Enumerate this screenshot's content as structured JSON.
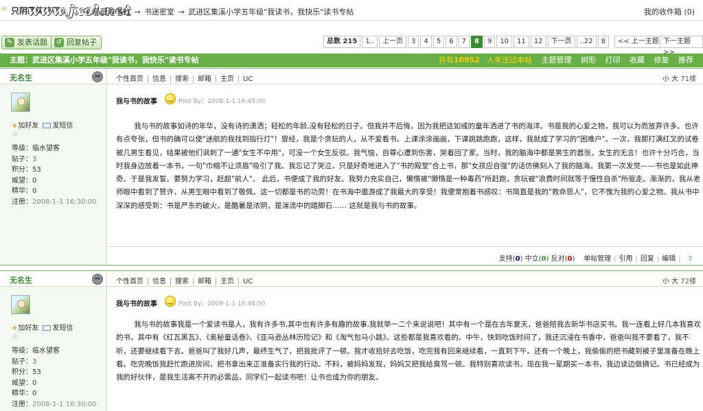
{
  "breadcrumb": {
    "site": "只阴暴笑冷不",
    "logo_text": "www.jxol.net",
    "items": [
      "局圆淳书社",
      "书迷密室",
      "武进区集溪小学五年级\"我读书，我快乐\"读书专帖"
    ],
    "separator": "→",
    "favorites": "我的收件箱 (0)"
  },
  "toolbar": {
    "new_topic": "发表话题",
    "reply": "回复帖子",
    "pager": {
      "total_label": "总数 215",
      "items": [
        "1..",
        "上一页",
        "3",
        "4",
        "5",
        "6",
        "7",
        "8",
        "9",
        "10",
        "11",
        "12",
        "下一页",
        "..22",
        "8"
      ],
      "current": "8"
    },
    "prev_topic": "<< 上一主题",
    "next_topic": "下一主题 >>"
  },
  "title_bar": {
    "label": "主题：武进区集溪小学五年级\"我读书，我快乐\"读书专帖",
    "viewers_prefix": "共有",
    "viewers_count": "10952",
    "viewers_suffix": "人关注过本帖",
    "actions": [
      "主题管理",
      "树形",
      "打印",
      "收藏",
      "修复",
      "推荐"
    ]
  },
  "posts": [
    {
      "author": "无名生",
      "add_friend": "加好友",
      "send_msg": "发短信",
      "stats": {
        "level": "等级：临水望客",
        "posts_label": "贴子：",
        "posts_value": "3",
        "points": "积分：53",
        "prestige": "威望：0",
        "essence": "精华：0",
        "registered": "注册：",
        "registered_value": "2008-1-1 16:30:00"
      },
      "ops": [
        "个性首页",
        "信息",
        "搜索",
        "邮箱",
        "主页",
        "UC"
      ],
      "size": "小 大",
      "floor": "71楼",
      "title": "我与书的故事",
      "meta": "Post By：2008-1-1 16:45:00",
      "body": "我与书的故事如诗的年华，没有诗的潇洒；轻松的年龄,没有轻松的日子。但我并不后悔，因为我把这如彧的童年洒进了书的海洋。书是我的心爱之物，我可以为而放弃许多。也许有点夸张，但书的确可以使\"迷航的我找到指行灯\"！曾经，我是个贪玩的人，从不爱看书。上课涂涂画画，下课跳跳跑跑，这样，我就成了学习的\"困难户\"。一次，我那打满红叉的试卷被几男生看见，结果被他们讽刺了一通\"女生不中用\"，可没一个女生反驳。我气恼，自尊心遭到伤害，哭着回了家。当时，我的脑海中都是男生的嚣张，女生的无言！也许十分巧合，当时我身边放着一本书，一句\"巾帼不让须眉\"吸引了我。我忘记了哭泣，只是好奇地进入了\"书的殿堂\"合上书，那\"女孩应自强\"的话仿佛刻入了我的脑海。我第一次发觉——书也是如此神奇。于是我发誓。要努力学习，赶超\"前人\"。 此后，书便成了我的好友。我努力充实自己，懒惰被\"懒惰是一种毒药\"所赶跑，贪玩被\"浪费时间就等于慢性自杀\"所驱走。渐渐的，我从老师眼中看到了赞许，从男生眼中看到了敬佩。这一切都是书的功劳！在书海中遨游成了我最大的享受！我便常抱着书感叹：书简直是我的\"救命恩人\"，它不愧为我的心爱之物。我从书中深深的感受到：书是严东的破火，是酷暑是浓阴，是湍流中的踏脚石…… 这就是我与书的故事。",
      "votes": {
        "support": "支持",
        "support_n": "0",
        "neutral": "中立",
        "neutral_n": "0",
        "oppose": "反对",
        "oppose_n": "0",
        "actions": [
          "单帖管理",
          "引用",
          "回复",
          "编辑"
        ]
      }
    },
    {
      "author": "无名生",
      "add_friend": "加好友",
      "send_msg": "发短信",
      "stats": {
        "level": "等级：临水望客",
        "posts_label": "贴子：",
        "posts_value": "3",
        "points": "积分：53",
        "prestige": "威望：0",
        "essence": "精华：0",
        "registered": "注册：",
        "registered_value": "2008-1-1 16:30:00"
      },
      "ops": [
        "个性首页",
        "信息",
        "搜索",
        "邮箱",
        "主页",
        "UC"
      ],
      "size": "小 大",
      "floor": "72楼",
      "title": "我与书的故事",
      "meta": "Post By：2008-1-1 16:48:00",
      "body": "我与书的故事我是一个爱读书是人，我有许多书,其中也有许多有趣的故事,我就举一二个来说说吧！其中有一个是在去年夏天，爸爸陪我去新华书店买书。我一连看上好几本我喜欢的书，其中有《红瓦黑瓦》、《奥秘童话卷》、《亚马逊丛林历险记》和《淘气包马小跳》。这些都是我喜欢看的。中午，快到吃饭时间了，我还沉浸在书香中，爸爸叫我不要看了，我不听，还要继续看下去。爸爸叫了我好几声，最终生气了，把我批评了一顿。我才收拾好去吃饭，吃完我有回来继续看，一直到下午。还有一个晚上，我偷偷的把书藏到被子里准备在晚上看。吃完晚饭我赶忙跑进房间，把书拿出来正准备实行我的行动。不料，被妈妈发现，妈妈又把我给臭骂一顿。我特别喜欢读书，现在我一星期买一本书，我边读边做摘记。书已经成为我的好伙伴，是我生活离不开的必需品，同学们一起读书吧！让书也成为你的朋友。"
    }
  ]
}
